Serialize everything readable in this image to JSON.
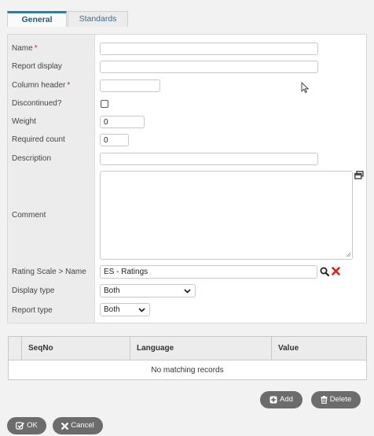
{
  "tabs": [
    {
      "label": "General",
      "active": true
    },
    {
      "label": "Standards",
      "active": false
    }
  ],
  "form": {
    "name": {
      "label": "Name",
      "required": "*",
      "value": ""
    },
    "report_display": {
      "label": "Report display",
      "value": ""
    },
    "column_header": {
      "label": "Column header",
      "required": "*",
      "value": ""
    },
    "discontinued": {
      "label": "Discontinued?",
      "checked": false
    },
    "weight": {
      "label": "Weight",
      "value": "0"
    },
    "required_count": {
      "label": "Required count",
      "value": "0"
    },
    "description": {
      "label": "Description",
      "value": ""
    },
    "comment": {
      "label": "Comment",
      "value": ""
    },
    "rating_scale": {
      "label": "Rating Scale > Name",
      "value": "ES - Ratings"
    },
    "display_type": {
      "label": "Display type",
      "value": "Both"
    },
    "report_type": {
      "label": "Report type",
      "value": "Both"
    }
  },
  "grid": {
    "columns": [
      "SeqNo",
      "Language",
      "Value"
    ],
    "empty_text": "No matching records"
  },
  "buttons": {
    "add": "Add",
    "delete": "Delete",
    "ok": "OK",
    "cancel": "Cancel"
  },
  "colors": {
    "accent": "#3c7a94",
    "required": "#cc2222",
    "pill_button": "#6c6c6c",
    "clear_icon": "#d0261e"
  },
  "icons": [
    "expand-window-icon",
    "search-icon",
    "clear-icon",
    "add-icon",
    "trash-icon",
    "check-icon",
    "x-icon",
    "chevron-down-icon",
    "resize-grip-icon"
  ]
}
